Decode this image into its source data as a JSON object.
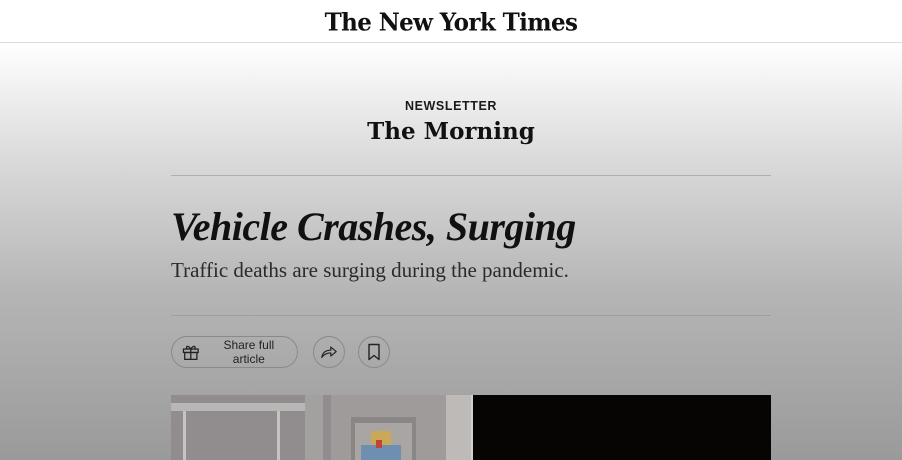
{
  "masthead": {
    "logo_text": "The New York Times"
  },
  "newsletter": {
    "kicker": "NEWSLETTER",
    "series": "The Morning"
  },
  "article": {
    "headline": "Vehicle Crashes, Surging",
    "summary": "Traffic deaths are surging during the pandemic."
  },
  "actions": {
    "share_label": "Share full article",
    "share_icon": "gift-icon",
    "forward_icon": "share-arrow-icon",
    "save_icon": "bookmark-icon"
  },
  "colors": {
    "text": "#111111",
    "border": "#8a8a8a",
    "background_top": "#ffffff",
    "background_bottom": "#9a9a9a"
  }
}
